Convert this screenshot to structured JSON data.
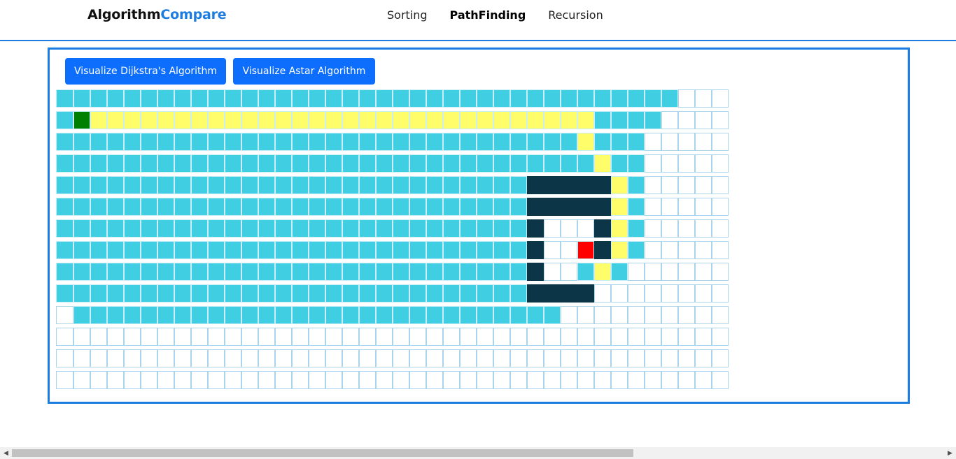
{
  "navbar": {
    "brand_primary": "Algorithm",
    "brand_accent": "Compare",
    "links": [
      {
        "label": "Sorting",
        "active": false
      },
      {
        "label": "PathFinding",
        "active": true
      },
      {
        "label": "Recursion",
        "active": false
      }
    ]
  },
  "controls": {
    "dijkstra_label": "Visualize Dijkstra's Algorithm",
    "astar_label": "Visualize Astar Algorithm"
  },
  "colors": {
    "accent": "#1d7ce0",
    "button": "#0d6efd",
    "visited": "#40cee3",
    "path": "#fffe6a",
    "wall": "#0c3547",
    "start": "#008000",
    "end": "#ff0000"
  },
  "grid": {
    "legend": "E=empty V=visited P=path W=wall S=start T=target",
    "rows": [
      "VVVVVVVVVVVVVVVVVVVVVVVVVVVVVVVVVVVVVEEEEEE",
      "VSPPPPPPPPPPPPPPPPPPPPPPPPPPPPPPVVVVEEEEE",
      "VVVVVVVVVVVVVVVVVVVVVVVVVVVVVVVPVVVEEEEE",
      "VVVVVVVVVVVVVVVVVVVVVVVVVVVVVVVVPVVEEEEE",
      "VVVVVVVVVVVVVVVVVVVVVVVVVVVVWWWWWPVEEEEE",
      "VVVVVVVVVVVVVVVVVVVVVVVVVVVVWWWWWPVEEEEE",
      "VVVVVVVVVVVVVVVVVVVVVVVVVVVVWEEEWPVEEEEE",
      "VVVVVVVVVVVVVVVVVVVVVVVVVVVVWEETWPVEEEEE",
      "VVVVVVVVVVVVVVVVVVVVVVVVVVVVWEEVPVEEEEEE",
      "VVVVVVVVVVVVVVVVVVVVVVVVVVVVWWWWEEEEEEEE",
      "EVVVVVVVVVVVVVVVVVVVVVVVVVVVVVEEEEEEEEEE",
      "EEEEEEEEEEEEEEEEEEEEEEEEEEEEEEEEEEEEEEEE",
      "EEEEEEEEEEEEEEEEEEEEEEEEEEEEEEEEEEEEEEEE",
      "EEEEEEEEEEEEEEEEEEEEEEEEEEEEEEEEEEEEEEEE"
    ]
  },
  "scrollbar": {
    "position_fraction": 0
  }
}
